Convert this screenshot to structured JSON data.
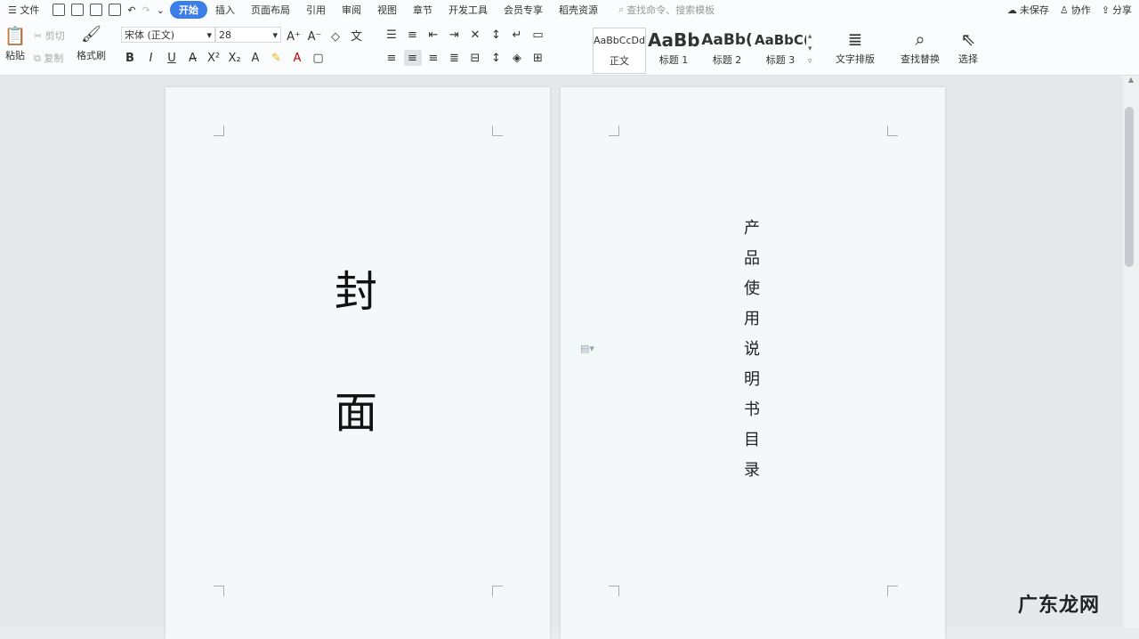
{
  "menubar": {
    "file": "文件",
    "tabs": [
      "开始",
      "插入",
      "页面布局",
      "引用",
      "审阅",
      "视图",
      "章节",
      "开发工具",
      "会员专享",
      "稻壳资源"
    ],
    "search_placeholder": "查找命令、搜索模板",
    "unsaved": "未保存",
    "collab": "协作",
    "share": "分享"
  },
  "ribbon": {
    "paste": "粘贴",
    "cut": "剪切",
    "copy": "复制",
    "format_painter": "格式刷",
    "font_name": "宋体 (正文)",
    "font_size": "28",
    "styles": [
      {
        "sample": "AaBbCcDd",
        "label": "正文"
      },
      {
        "sample": "AaBb",
        "label": "标题 1"
      },
      {
        "sample": "AaBb(",
        "label": "标题 2"
      },
      {
        "sample": "AaBbC(",
        "label": "标题 3"
      }
    ],
    "text_layout": "文字排版",
    "find_replace": "查找替换",
    "select": "选择"
  },
  "document": {
    "cover_chars": [
      "封",
      "面"
    ],
    "vertical_chars": [
      "产",
      "品",
      "使",
      "用",
      "说",
      "明",
      "书",
      "目",
      "录"
    ]
  },
  "watermark": "广东龙网"
}
